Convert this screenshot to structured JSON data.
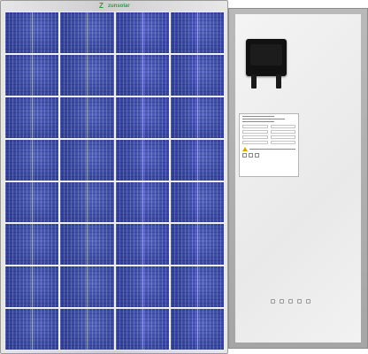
{
  "product": {
    "brand_name": "zunsolar",
    "brand_tagline": "",
    "brand_color": "#2e9a42",
    "cell_color": "#3c4ca6",
    "frame_color": "#b0b0b0"
  },
  "front_panel": {
    "cell_columns": 4,
    "cell_rows": 8
  },
  "back_panel": {
    "junction_box": "junction-box",
    "label": "spec-label"
  }
}
